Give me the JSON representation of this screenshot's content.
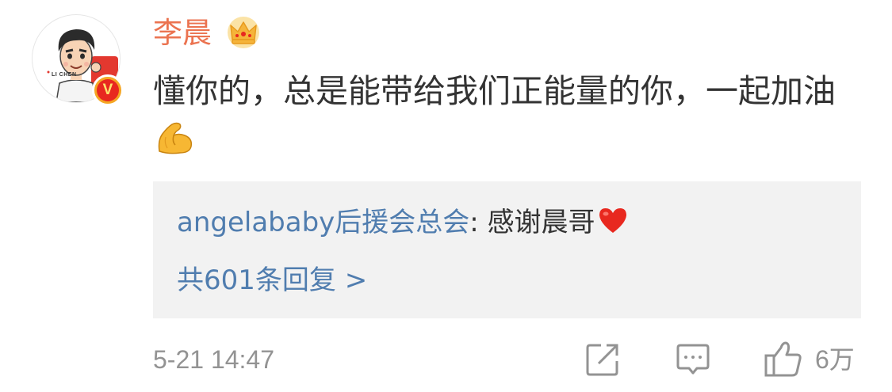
{
  "comment": {
    "avatar": {
      "label": "LI CHEN",
      "badge_letter": "V",
      "badge_color": "#f5a623"
    },
    "username": "李晨",
    "username_color": "#eb7350",
    "crown_icon": "crown-icon",
    "text": "懂你的，总是能带给我们正能量的你，一起加油",
    "text_emoji": "muscle-emoji",
    "reply": {
      "author": "angelababy后援会总会",
      "separator": ": ",
      "content": "感谢晨哥",
      "content_emoji": "heart-emoji",
      "count_label": "共601条回复 >",
      "link_color": "#507daf"
    },
    "timestamp": "5-21 14:47",
    "actions": {
      "forward_icon": "share-icon",
      "comment_icon": "comment-icon",
      "like_icon": "thumbs-up-icon",
      "like_count": "6万"
    }
  }
}
